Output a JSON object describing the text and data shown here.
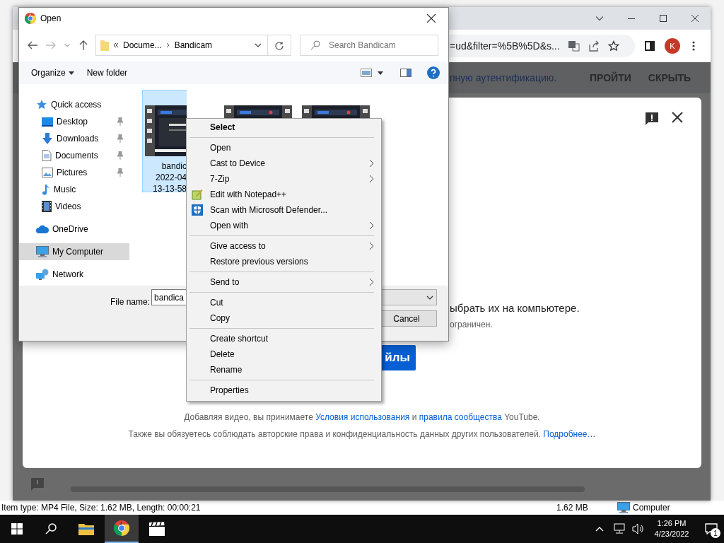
{
  "status_bar": {
    "item_info": "Item type: MP4 File, Size: 1.62 MB, Length: 00:00:21",
    "size": "1.62 MB",
    "location": "Computer"
  },
  "browser": {
    "url": "=ud&filter=%5B%5D&s...",
    "avatar": "K",
    "banner": {
      "text": "пную аутентификацию.",
      "actions": [
        "ПРОЙТИ",
        "СКРЫТЬ"
      ]
    },
    "upload_dialog": {
      "prompt": "ыбрать их на компьютере.",
      "note": "ограничен.",
      "button": "йлы",
      "terms": [
        {
          "text": "Добавляя видео, вы принимаете ",
          "link": false
        },
        {
          "text": "Условия использования",
          "link": true
        },
        {
          "text": " и ",
          "link": false
        },
        {
          "text": "правила сообщества",
          "link": true
        },
        {
          "text": " YouTube.",
          "link": false
        }
      ],
      "notice": [
        {
          "text": "Также вы обязуетесь соблюдать авторские права и конфиденциальность данных других пользователей. ",
          "link": false
        },
        {
          "text": "Подробнее…",
          "link": true
        }
      ]
    }
  },
  "open_dialog": {
    "title": "Open",
    "path": [
      "Docume...",
      "Bandicam"
    ],
    "search": {
      "placeholder": "Search Bandicam"
    },
    "commands": [
      "Organize",
      "New folder"
    ],
    "nav": [
      {
        "label": "Quick access",
        "kind": "star",
        "pinned": false,
        "selected": false,
        "children": [
          {
            "label": "Desktop",
            "kind": "desktop",
            "pinned": true,
            "selected": false
          },
          {
            "label": "Downloads",
            "kind": "download",
            "pinned": true,
            "selected": false
          },
          {
            "label": "Documents",
            "kind": "document",
            "pinned": true,
            "selected": false
          },
          {
            "label": "Pictures",
            "kind": "pictures",
            "pinned": true,
            "selected": false
          },
          {
            "label": "Music",
            "kind": "music",
            "pinned": false,
            "selected": false
          },
          {
            "label": "Videos",
            "kind": "film",
            "pinned": false,
            "selected": false
          }
        ]
      },
      {
        "label": "OneDrive",
        "kind": "cloud",
        "pinned": false,
        "selected": false
      },
      {
        "label": "My Computer",
        "kind": "computer",
        "pinned": false,
        "selected": true
      },
      {
        "label": "Network",
        "kind": "network",
        "pinned": false,
        "selected": false
      }
    ],
    "files": [
      {
        "lines": [
          "bandic",
          "2022-04",
          "13-13-58"
        ],
        "selected": true
      },
      {
        "selected": false
      },
      {
        "selected": false
      }
    ],
    "file_name": {
      "label": "File name:",
      "value": "bandica"
    },
    "cancel": "Cancel"
  },
  "context_menu": {
    "groups": [
      [
        {
          "label": "Select",
          "kind": "default",
          "submenu": false
        }
      ],
      [
        {
          "label": "Open",
          "kind": "plain",
          "submenu": false
        },
        {
          "label": "Cast to Device",
          "kind": "plain",
          "submenu": true
        },
        {
          "label": "7-Zip",
          "kind": "plain",
          "submenu": true
        },
        {
          "label": "Edit with Notepad++",
          "kind": "notepad",
          "submenu": false
        },
        {
          "label": "Scan with Microsoft Defender...",
          "kind": "defender",
          "submenu": false
        },
        {
          "label": "Open with",
          "kind": "plain",
          "submenu": true
        }
      ],
      [
        {
          "label": "Give access to",
          "kind": "plain",
          "submenu": true
        },
        {
          "label": "Restore previous versions",
          "kind": "plain",
          "submenu": false
        }
      ],
      [
        {
          "label": "Send to",
          "kind": "plain",
          "submenu": true
        }
      ],
      [
        {
          "label": "Cut",
          "kind": "plain",
          "submenu": false
        },
        {
          "label": "Copy",
          "kind": "plain",
          "submenu": false
        }
      ],
      [
        {
          "label": "Create shortcut",
          "kind": "plain",
          "submenu": false
        },
        {
          "label": "Delete",
          "kind": "plain",
          "submenu": false
        },
        {
          "label": "Rename",
          "kind": "plain",
          "submenu": false
        }
      ],
      [
        {
          "label": "Properties",
          "kind": "plain",
          "submenu": false
        }
      ]
    ]
  },
  "taskbar": {
    "apps": [
      {
        "kind": "explorer",
        "active": false
      },
      {
        "kind": "chrome",
        "active": true
      },
      {
        "kind": "clapper",
        "active": false
      }
    ],
    "time": "1:26 PM",
    "date": "4/23/2022",
    "notifications": "1"
  }
}
